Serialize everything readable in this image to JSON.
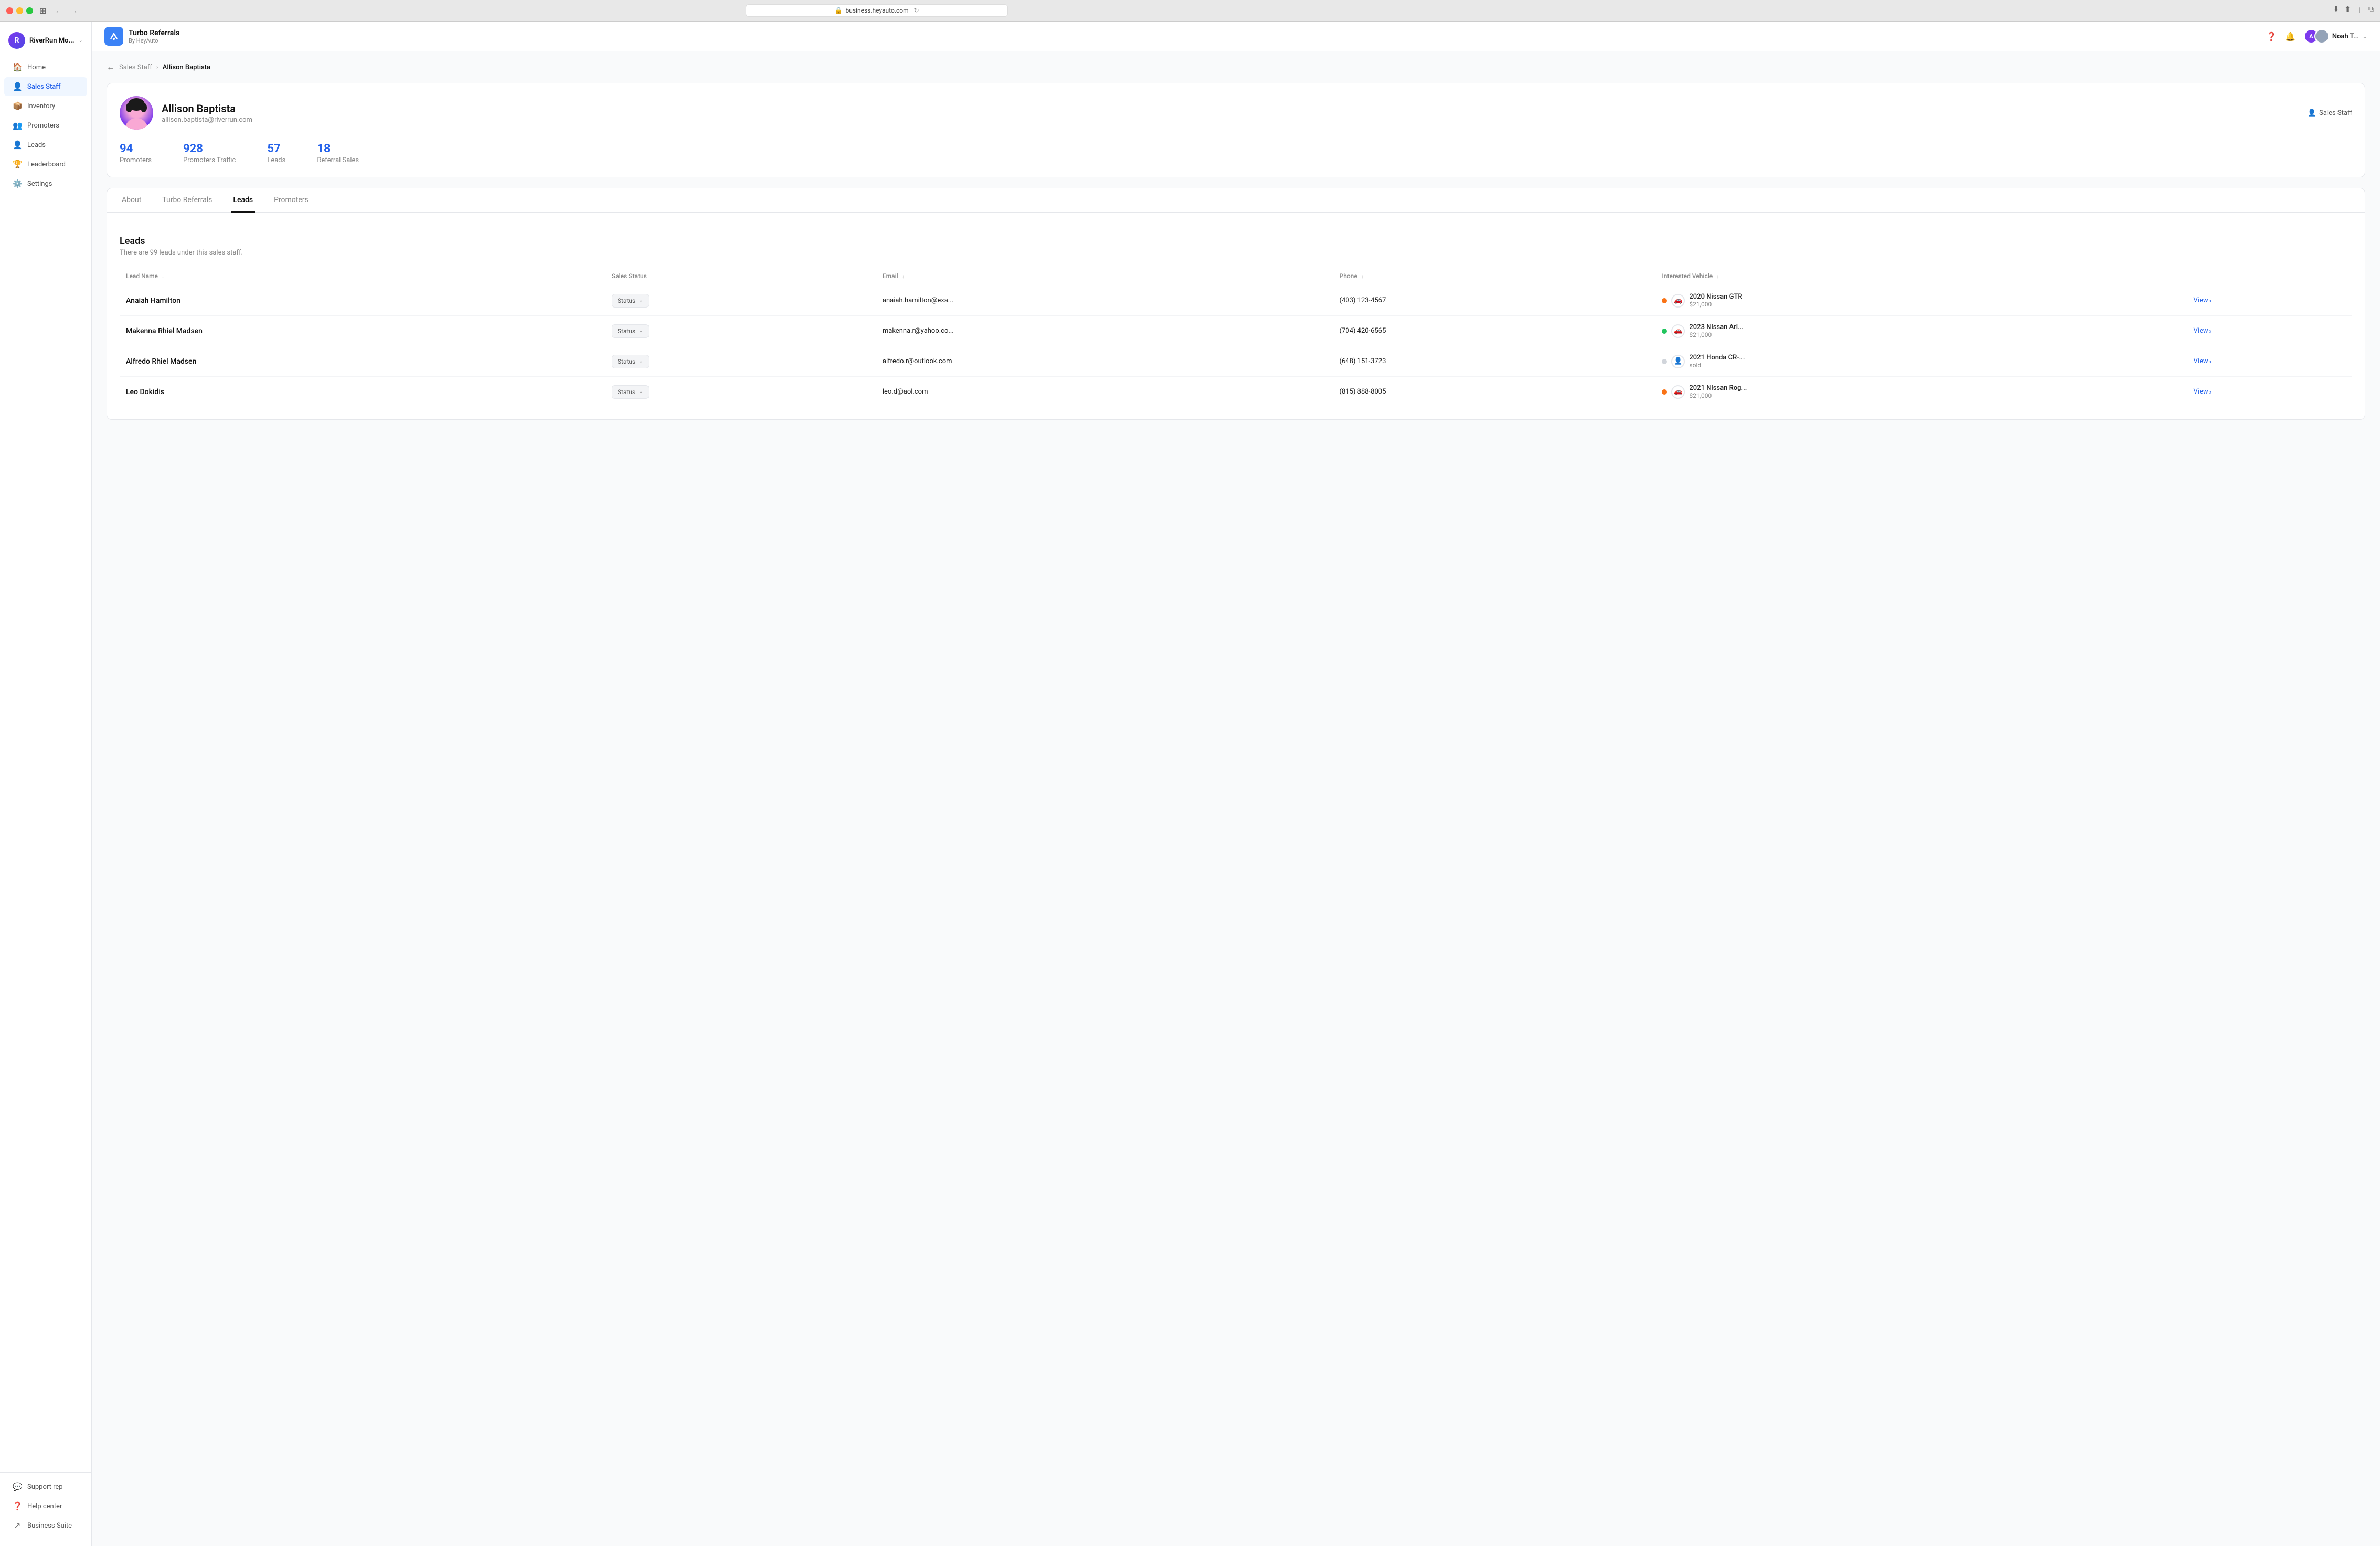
{
  "browser": {
    "url": "business.heyauto.com",
    "back_icon": "←",
    "forward_icon": "→"
  },
  "topbar": {
    "app_name": "Turbo Referrals",
    "app_sub": "By HeyAuto",
    "user_name": "Noah T...",
    "help_icon": "?",
    "bell_icon": "🔔"
  },
  "sidebar": {
    "company": "RiverRun Mo...",
    "nav_items": [
      {
        "id": "home",
        "label": "Home",
        "icon": "🏠"
      },
      {
        "id": "sales-staff",
        "label": "Sales Staff",
        "icon": "👤",
        "active": true
      },
      {
        "id": "inventory",
        "label": "Inventory",
        "icon": "📦"
      },
      {
        "id": "promoters",
        "label": "Promoters",
        "icon": "👥"
      },
      {
        "id": "leads",
        "label": "Leads",
        "icon": "👤"
      },
      {
        "id": "leaderboard",
        "label": "Leaderboard",
        "icon": "🏆"
      },
      {
        "id": "settings",
        "label": "Settings",
        "icon": "⚙️"
      }
    ],
    "bottom_items": [
      {
        "id": "support-rep",
        "label": "Support rep",
        "icon": "💬"
      },
      {
        "id": "help-center",
        "label": "Help center",
        "icon": "❓"
      },
      {
        "id": "business-suite",
        "label": "Business Suite",
        "icon": "↗"
      }
    ]
  },
  "breadcrumb": {
    "back": "←",
    "parent": "Sales Staff",
    "separator": "›",
    "current": "Allison Baptista"
  },
  "profile": {
    "name": "Allison Baptista",
    "email": "allison.baptista@riverrun.com",
    "role": "Sales Staff",
    "stats": [
      {
        "value": "94",
        "label": "Promoters"
      },
      {
        "value": "928",
        "label": "Promoters Traffic"
      },
      {
        "value": "57",
        "label": "Leads"
      },
      {
        "value": "18",
        "label": "Referral Sales"
      }
    ]
  },
  "tabs": [
    {
      "id": "about",
      "label": "About",
      "active": false
    },
    {
      "id": "turbo-referrals",
      "label": "Turbo Referrals",
      "active": false
    },
    {
      "id": "leads",
      "label": "Leads",
      "active": true
    },
    {
      "id": "promoters",
      "label": "Promoters",
      "active": false
    }
  ],
  "leads_section": {
    "title": "Leads",
    "subtitle": "There are 99 leads under this sales staff.",
    "columns": [
      {
        "id": "lead-name",
        "label": "Lead Name"
      },
      {
        "id": "sales-status",
        "label": "Sales Status"
      },
      {
        "id": "email",
        "label": "Email"
      },
      {
        "id": "phone",
        "label": "Phone"
      },
      {
        "id": "interested-vehicle",
        "label": "Interested Vehicle"
      }
    ],
    "rows": [
      {
        "name": "Anaiah Hamilton",
        "status": "Status",
        "email": "anaiah.hamilton@exa...",
        "phone": "(403) 123-4567",
        "vehicle": "2020 Nissan GTR",
        "vehicle_price": "$21,000",
        "vehicle_status": "orange",
        "vehicle_icon": "🚗",
        "view_label": "View"
      },
      {
        "name": "Makenna Rhiel Madsen",
        "status": "Status",
        "email": "makenna.r@yahoo.co...",
        "phone": "(704) 420-6565",
        "vehicle": "2023 Nissan Ari...",
        "vehicle_price": "$21,000",
        "vehicle_status": "green",
        "vehicle_icon": "🚗",
        "view_label": "View"
      },
      {
        "name": "Alfredo Rhiel Madsen",
        "status": "Status",
        "email": "alfredo.r@outlook.com",
        "phone": "(648) 151-3723",
        "vehicle": "2021 Honda CR-...",
        "vehicle_price": "sold",
        "vehicle_status": "gray",
        "vehicle_icon": "👤",
        "view_label": "View"
      },
      {
        "name": "Leo Dokidis",
        "status": "Status",
        "email": "leo.d@aol.com",
        "phone": "(815) 888-8005",
        "vehicle": "2021 Nissan Rog...",
        "vehicle_price": "$21,000",
        "vehicle_status": "orange",
        "vehicle_icon": "🚗",
        "view_label": "View"
      }
    ]
  }
}
